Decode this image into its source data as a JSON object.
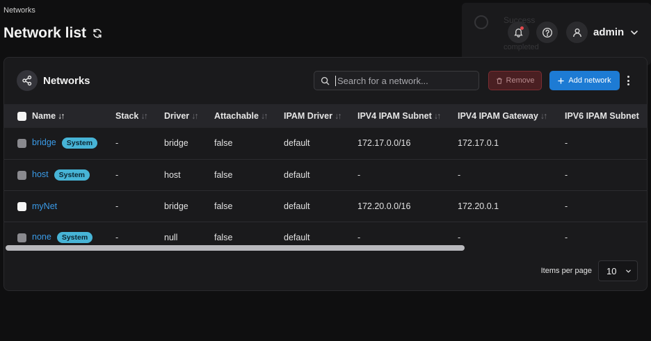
{
  "breadcrumb": "Networks",
  "page_title": "Network list",
  "toast": {
    "title": "Success",
    "text": "completed"
  },
  "header": {
    "username": "admin"
  },
  "panel": {
    "title": "Networks",
    "search_placeholder": "Search for a network...",
    "remove_label": "Remove",
    "add_label": "Add network"
  },
  "table": {
    "columns": [
      "Name",
      "Stack",
      "Driver",
      "Attachable",
      "IPAM Driver",
      "IPV4 IPAM Subnet",
      "IPV4 IPAM Gateway",
      "IPV6 IPAM Subnet"
    ],
    "rows": [
      {
        "name": "bridge",
        "badge": "System",
        "stack": "-",
        "driver": "bridge",
        "attachable": "false",
        "ipam_driver": "default",
        "ipv4_subnet": "172.17.0.0/16",
        "ipv4_gateway": "172.17.0.1",
        "ipv6_subnet": "-"
      },
      {
        "name": "host",
        "badge": "System",
        "stack": "-",
        "driver": "host",
        "attachable": "false",
        "ipam_driver": "default",
        "ipv4_subnet": "-",
        "ipv4_gateway": "-",
        "ipv6_subnet": "-"
      },
      {
        "name": "myNet",
        "badge": "",
        "stack": "-",
        "driver": "bridge",
        "attachable": "false",
        "ipam_driver": "default",
        "ipv4_subnet": "172.20.0.0/16",
        "ipv4_gateway": "172.20.0.1",
        "ipv6_subnet": "-"
      },
      {
        "name": "none",
        "badge": "System",
        "stack": "-",
        "driver": "null",
        "attachable": "false",
        "ipam_driver": "default",
        "ipv4_subnet": "-",
        "ipv4_gateway": "-",
        "ipv6_subnet": "-"
      }
    ]
  },
  "pagination": {
    "label": "Items per page",
    "value": "10"
  },
  "colors": {
    "accent": "#1d7bd4",
    "link": "#3a9be8",
    "badge": "#47b4d6",
    "danger": "#7c2d32"
  }
}
